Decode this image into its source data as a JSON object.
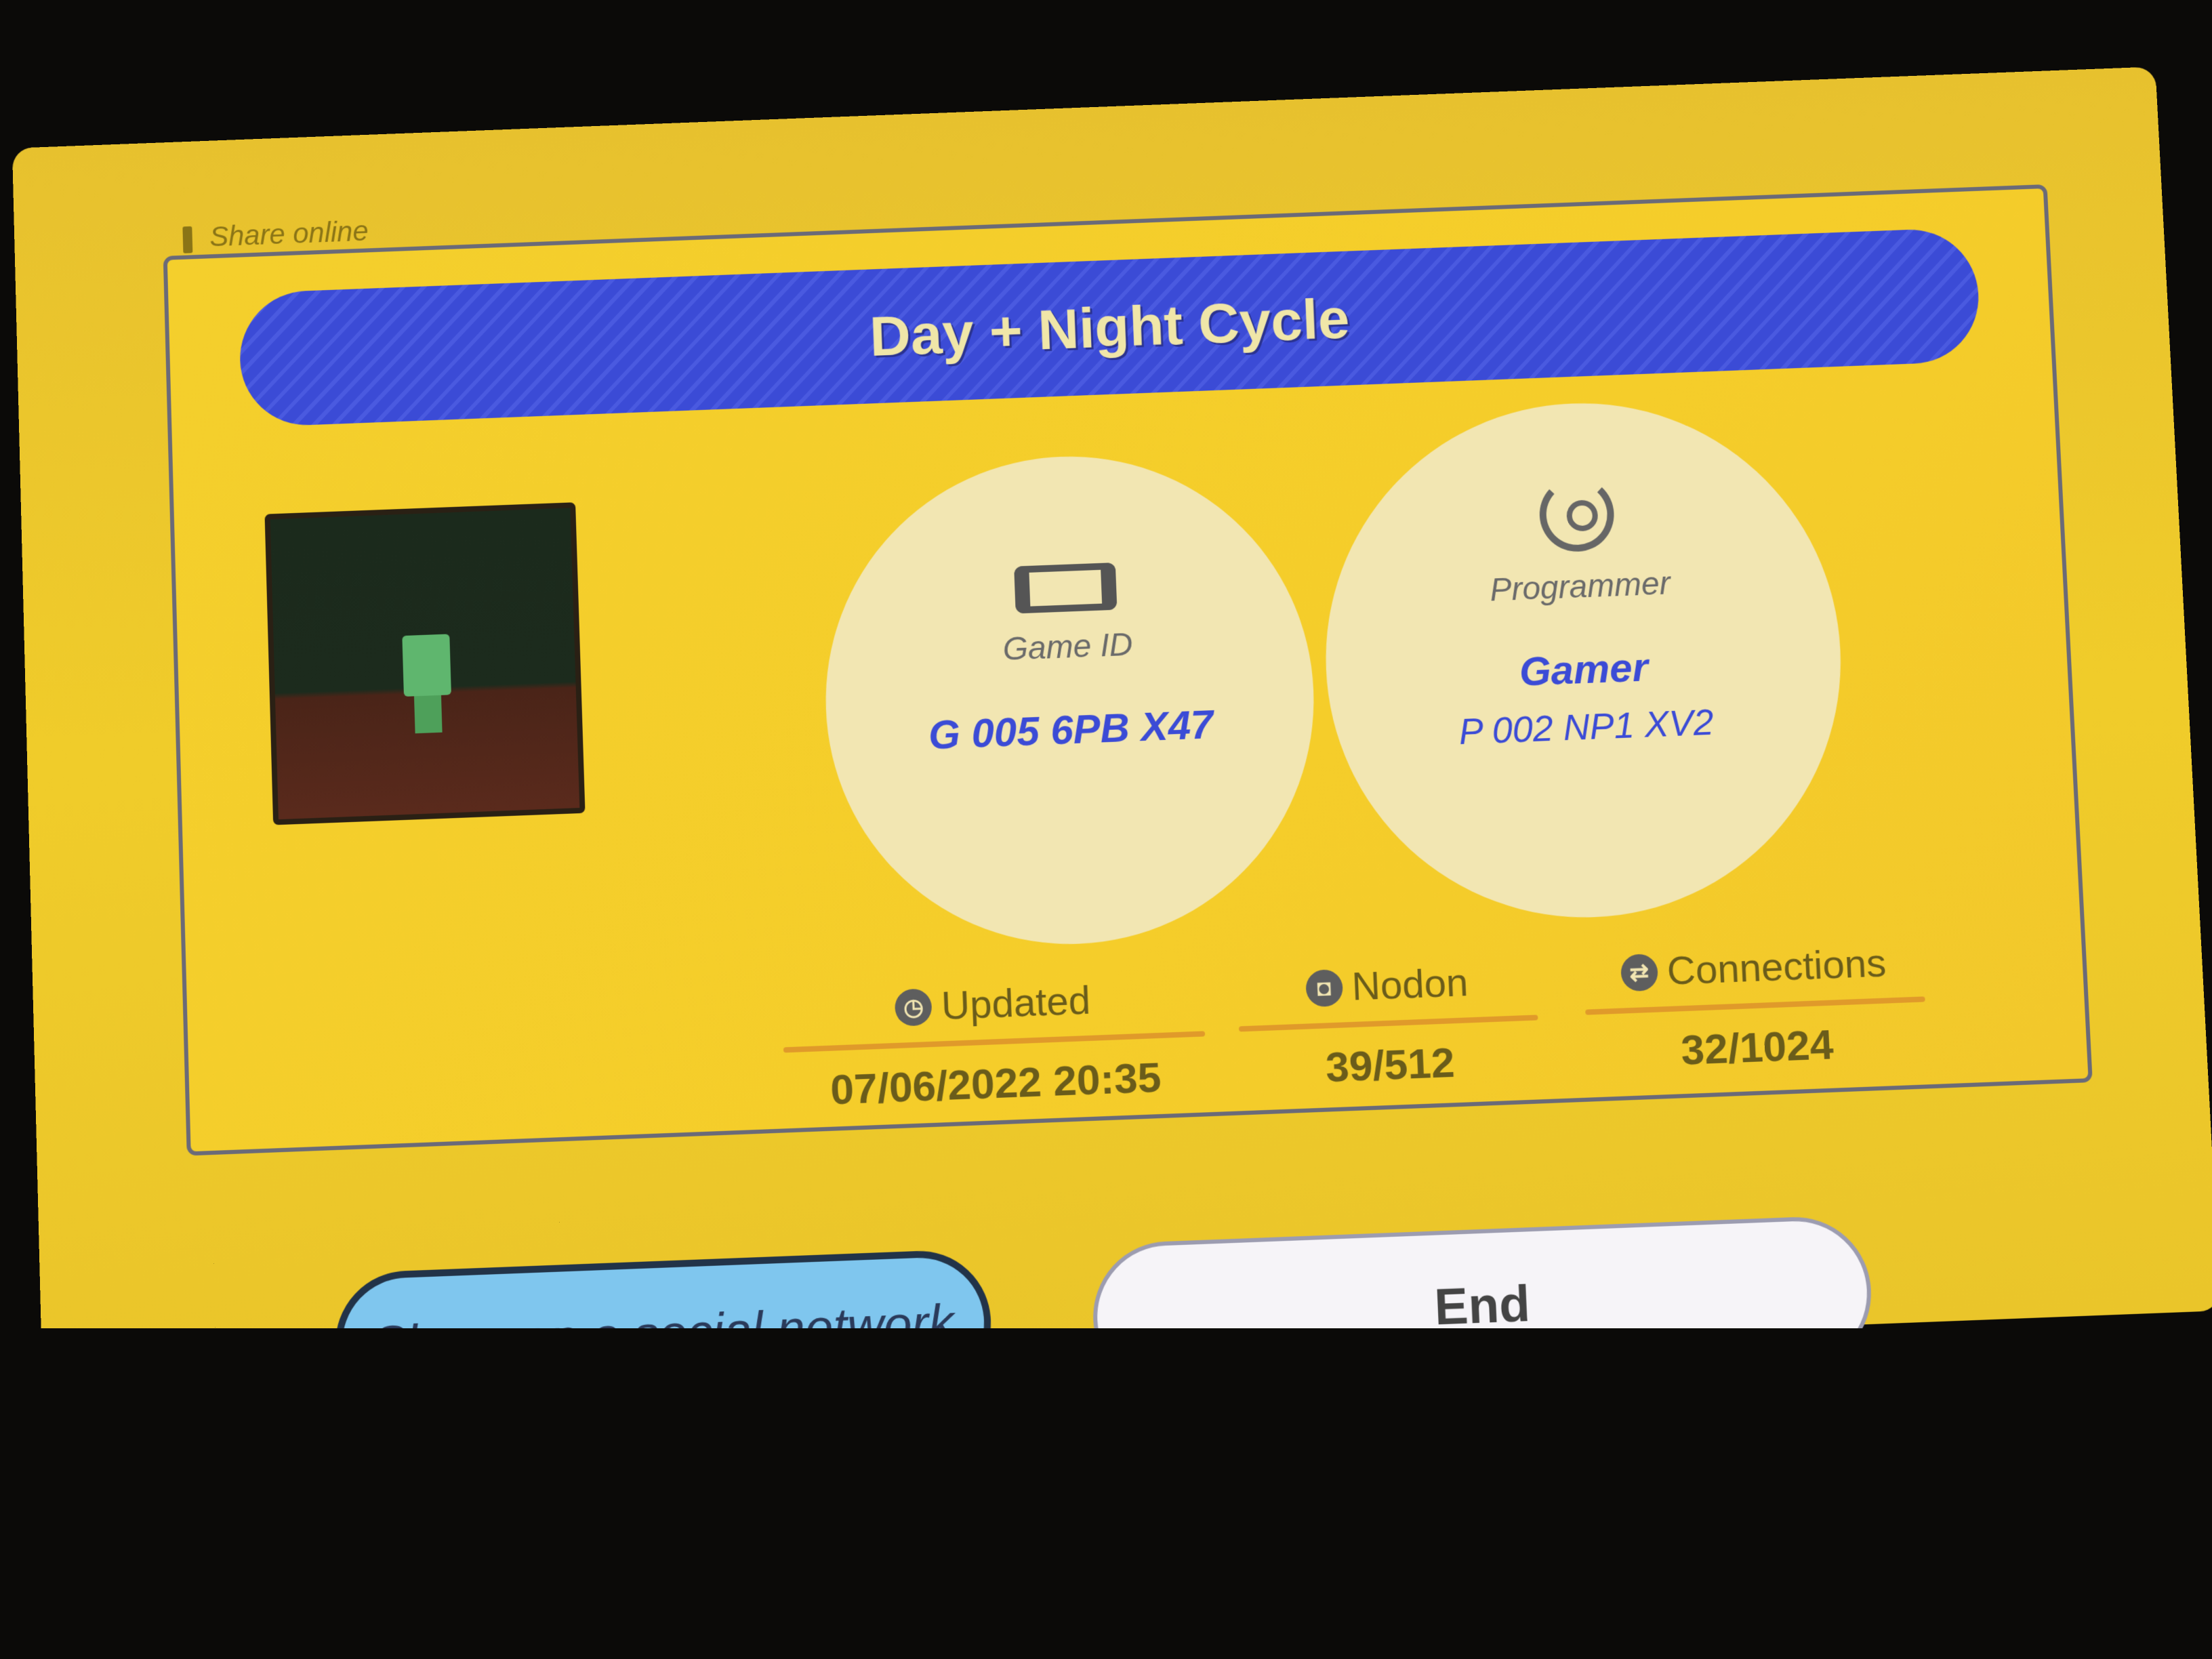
{
  "header": {
    "label": "Share online"
  },
  "title": "Day + Night Cycle",
  "game_id": {
    "label": "Game ID",
    "value": "G 005 6PB X47"
  },
  "programmer": {
    "label": "Programmer",
    "name": "Gamer",
    "id": "P 002 NP1 XV2"
  },
  "stats": {
    "updated": {
      "label": "Updated",
      "value": "07/06/2022 20:35",
      "icon": "clock-icon"
    },
    "nodon": {
      "label": "Nodon",
      "value": "39/512",
      "icon": "nodon-icon"
    },
    "connections": {
      "label": "Connections",
      "value": "32/1024",
      "icon": "link-icon"
    }
  },
  "buttons": {
    "share": "Share on a social network",
    "end": "End"
  },
  "colors": {
    "background_yellow": "#f4cf2c",
    "title_blue": "#3b4bd6",
    "share_button": "#7fc6ee",
    "end_button": "#f6f4f8"
  }
}
